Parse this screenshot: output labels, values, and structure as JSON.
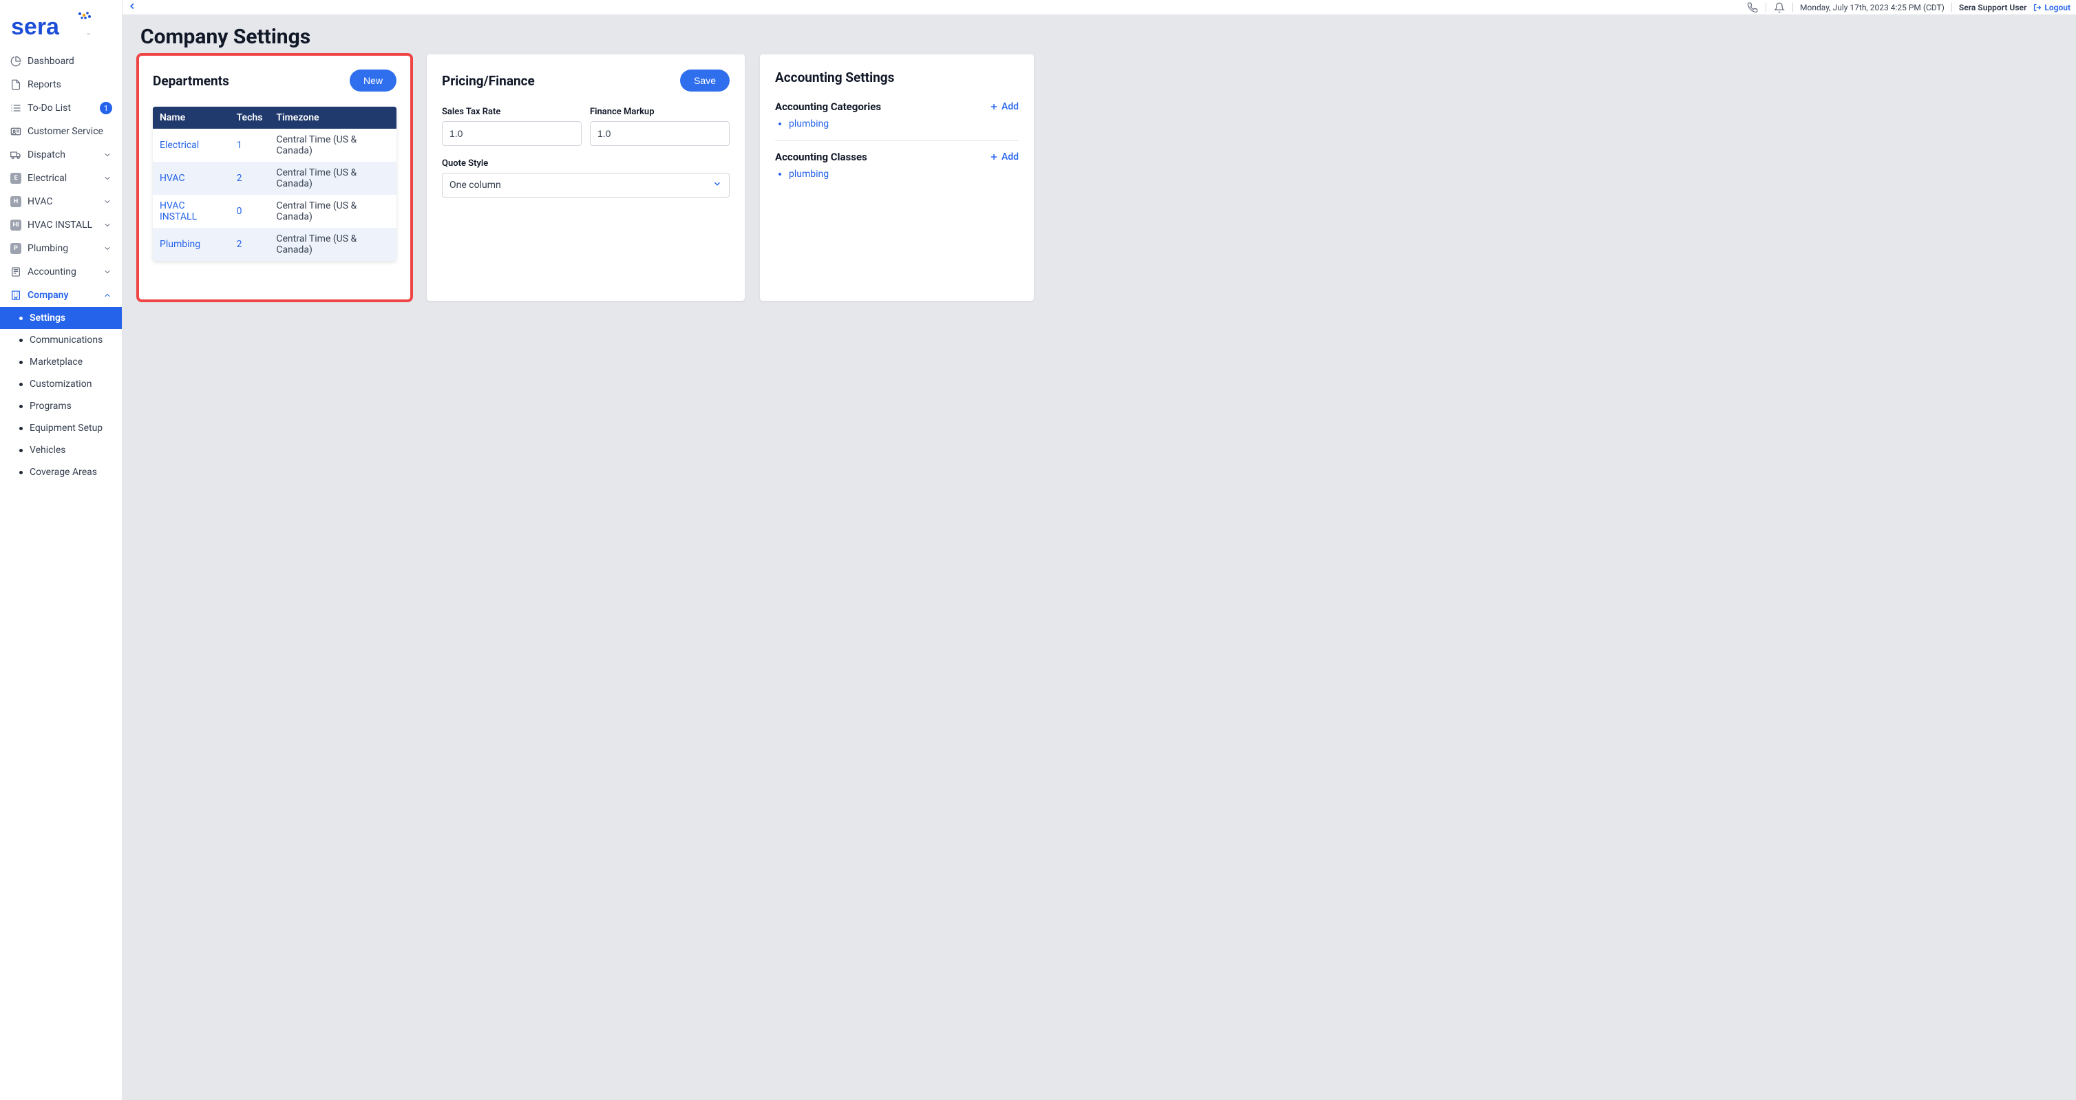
{
  "header": {
    "datetime": "Monday, July 17th, 2023 4:25 PM (CDT)",
    "user_name": "Sera Support User",
    "logout_label": "Logout"
  },
  "page": {
    "title": "Company Settings"
  },
  "sidebar": {
    "items": [
      {
        "label": "Dashboard",
        "icon": "pie-chart-icon",
        "badge": null,
        "expandable": false
      },
      {
        "label": "Reports",
        "icon": "document-icon",
        "badge": null,
        "expandable": false
      },
      {
        "label": "To-Do List",
        "icon": "list-icon",
        "badge": "1",
        "expandable": false
      },
      {
        "label": "Customer Service",
        "icon": "id-card-icon",
        "badge": null,
        "expandable": false
      },
      {
        "label": "Dispatch",
        "icon": "truck-icon",
        "badge": null,
        "expandable": true
      },
      {
        "label": "Electrical",
        "icon": "dept-E",
        "badge": null,
        "expandable": true
      },
      {
        "label": "HVAC",
        "icon": "dept-H",
        "badge": null,
        "expandable": true
      },
      {
        "label": "HVAC INSTALL",
        "icon": "dept-HI",
        "badge": null,
        "expandable": true
      },
      {
        "label": "Plumbing",
        "icon": "dept-P",
        "badge": null,
        "expandable": true
      },
      {
        "label": "Accounting",
        "icon": "ledger-icon",
        "badge": null,
        "expandable": true
      },
      {
        "label": "Company",
        "icon": "building-icon",
        "badge": null,
        "expandable": true,
        "active": true
      }
    ],
    "company_sub": [
      {
        "label": "Settings",
        "active": true
      },
      {
        "label": "Communications"
      },
      {
        "label": "Marketplace"
      },
      {
        "label": "Customization"
      },
      {
        "label": "Programs"
      },
      {
        "label": "Equipment Setup"
      },
      {
        "label": "Vehicles"
      },
      {
        "label": "Coverage Areas"
      }
    ]
  },
  "departments": {
    "title": "Departments",
    "new_button": "New",
    "columns": [
      "Name",
      "Techs",
      "Timezone"
    ],
    "rows": [
      {
        "name": "Electrical",
        "techs": "1",
        "tz": "Central Time (US & Canada)"
      },
      {
        "name": "HVAC",
        "techs": "2",
        "tz": "Central Time (US & Canada)"
      },
      {
        "name": "HVAC INSTALL",
        "techs": "0",
        "tz": "Central Time (US & Canada)"
      },
      {
        "name": "Plumbing",
        "techs": "2",
        "tz": "Central Time (US & Canada)"
      }
    ]
  },
  "pricing": {
    "title": "Pricing/Finance",
    "save_button": "Save",
    "sales_tax_label": "Sales Tax Rate",
    "sales_tax_value": "1.0",
    "finance_markup_label": "Finance Markup",
    "finance_markup_value": "1.0",
    "quote_style_label": "Quote Style",
    "quote_style_value": "One column"
  },
  "accounting": {
    "title": "Accounting Settings",
    "categories_label": "Accounting Categories",
    "classes_label": "Accounting Classes",
    "add_label": "Add",
    "categories": [
      "plumbing"
    ],
    "classes": [
      "plumbing"
    ]
  }
}
